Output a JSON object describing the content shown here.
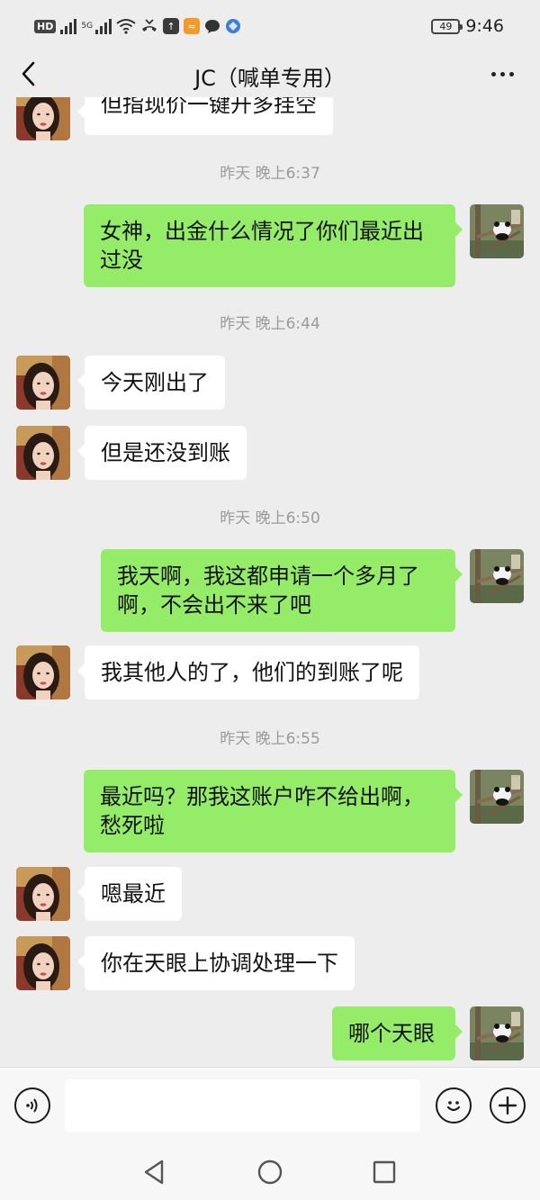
{
  "status_bar": {
    "hd_label": "HD",
    "network_label": "5G",
    "battery_level": "49",
    "time": "9:46",
    "app_colors": [
      "#f39a2b",
      "#3a3a3a",
      "#3b7fd9"
    ]
  },
  "nav": {
    "title": "JC（喊单专用）",
    "back_icon": "chevron-left-icon",
    "more_icon": "more-dots-icon"
  },
  "messages": {
    "partial_top_text": "但指现价一键开多挂空",
    "ts1": "昨天 晚上6:37",
    "m1": [
      "女神，出金什么情况了你们最近出",
      "过没"
    ],
    "ts2": "昨天 晚上6:44",
    "m2": "今天刚出了",
    "m3": "但是还没到账",
    "ts3": "昨天 晚上6:50",
    "m4": [
      "我天啊，我这都申请一个多月了",
      "啊，不会出不来了吧"
    ],
    "m5": "我其他人的了，他们的到账了呢",
    "ts4": "昨天 晚上6:55",
    "m6": [
      "最近吗？那我这账户咋不给出啊，",
      "愁死啦"
    ],
    "m7": "嗯最近",
    "m8": "你在天眼上协调处理一下",
    "m9": "哪个天眼"
  },
  "input_bar": {
    "voice_icon": "voice-icon",
    "emoji_icon": "emoji-icon",
    "plus_icon": "plus-icon",
    "input_value": ""
  },
  "system_nav": {
    "back_icon": "triangle-back-icon",
    "home_icon": "circle-home-icon",
    "recents_icon": "square-recents-icon"
  },
  "colors": {
    "background": "#ededed",
    "sent_bubble": "#95ec69",
    "received_bubble": "#ffffff",
    "timestamp": "#9b9b9b"
  }
}
